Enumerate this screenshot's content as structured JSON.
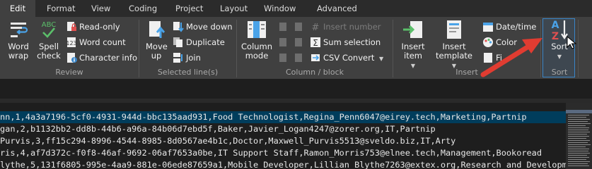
{
  "tabs": [
    "Edit",
    "Format",
    "View",
    "Coding",
    "Project",
    "Layout",
    "Window",
    "Advanced"
  ],
  "active_tab": "Edit",
  "ribbon": {
    "review": {
      "label": "Review",
      "word_wrap": "Word wrap",
      "spell_check": "Spell check",
      "spell_icon_text": "ABC",
      "read_only": "Read-only",
      "word_count": "Word count",
      "character_info": "Character info"
    },
    "selected_lines": {
      "label": "Selected line(s)",
      "move_up": "Move up",
      "move_down": "Move down",
      "duplicate": "Duplicate",
      "join": "Join"
    },
    "column_block": {
      "label": "Column / block",
      "column_mode": "Column mode",
      "insert_number": "Insert number",
      "sum_selection": "Sum selection",
      "csv_convert": "CSV Convert"
    },
    "insert": {
      "label": "Insert",
      "insert_item": "Insert item",
      "insert_template": "Insert template",
      "date_time": "Date/time",
      "color": "Color",
      "file_partial": "Fi"
    },
    "sort": {
      "label": "Sort",
      "sort_button": "Sort",
      "icon_a": "A",
      "icon_z": "Z"
    }
  },
  "colors": {
    "ribbon_bg": "#404040",
    "tab_bg": "#2b2b2b",
    "editor_bg": "#1e1e1e",
    "current_line_bg": "#003d5c",
    "accent_blue": "#3a86c8",
    "annotation_arrow": "#e03c31"
  },
  "editor": {
    "lines": [
      "nn,1,4a3a7196-5cf0-4931-944d-bbc135aad931,Food Technologist,Regina_Penn6047@eirey.tech,Marketing,Partnip",
      "gan,2,b1132bb2-dd8b-44b6-a96a-84b06d7ebd5f,Baker,Javier_Logan4247@zorer.org,IT,Partnip",
      "Purvis,3,ff15c294-8996-4544-8985-8d0567ae4b1c,Doctor,Maxwell_Purvis5513@sveldo.biz,IT,Arty",
      "ris,4,af7d372c-f0f8-46af-9692-06af7653a0be,IT Support Staff,Ramon_Morris753@elnee.tech,Management,Bookoread",
      "lythe,5,131f6805-995e-4aa9-881e-06ede87659a1,Mobile Developer,Lillian_Blythe7263@extex.org,Research and Developmen"
    ]
  }
}
